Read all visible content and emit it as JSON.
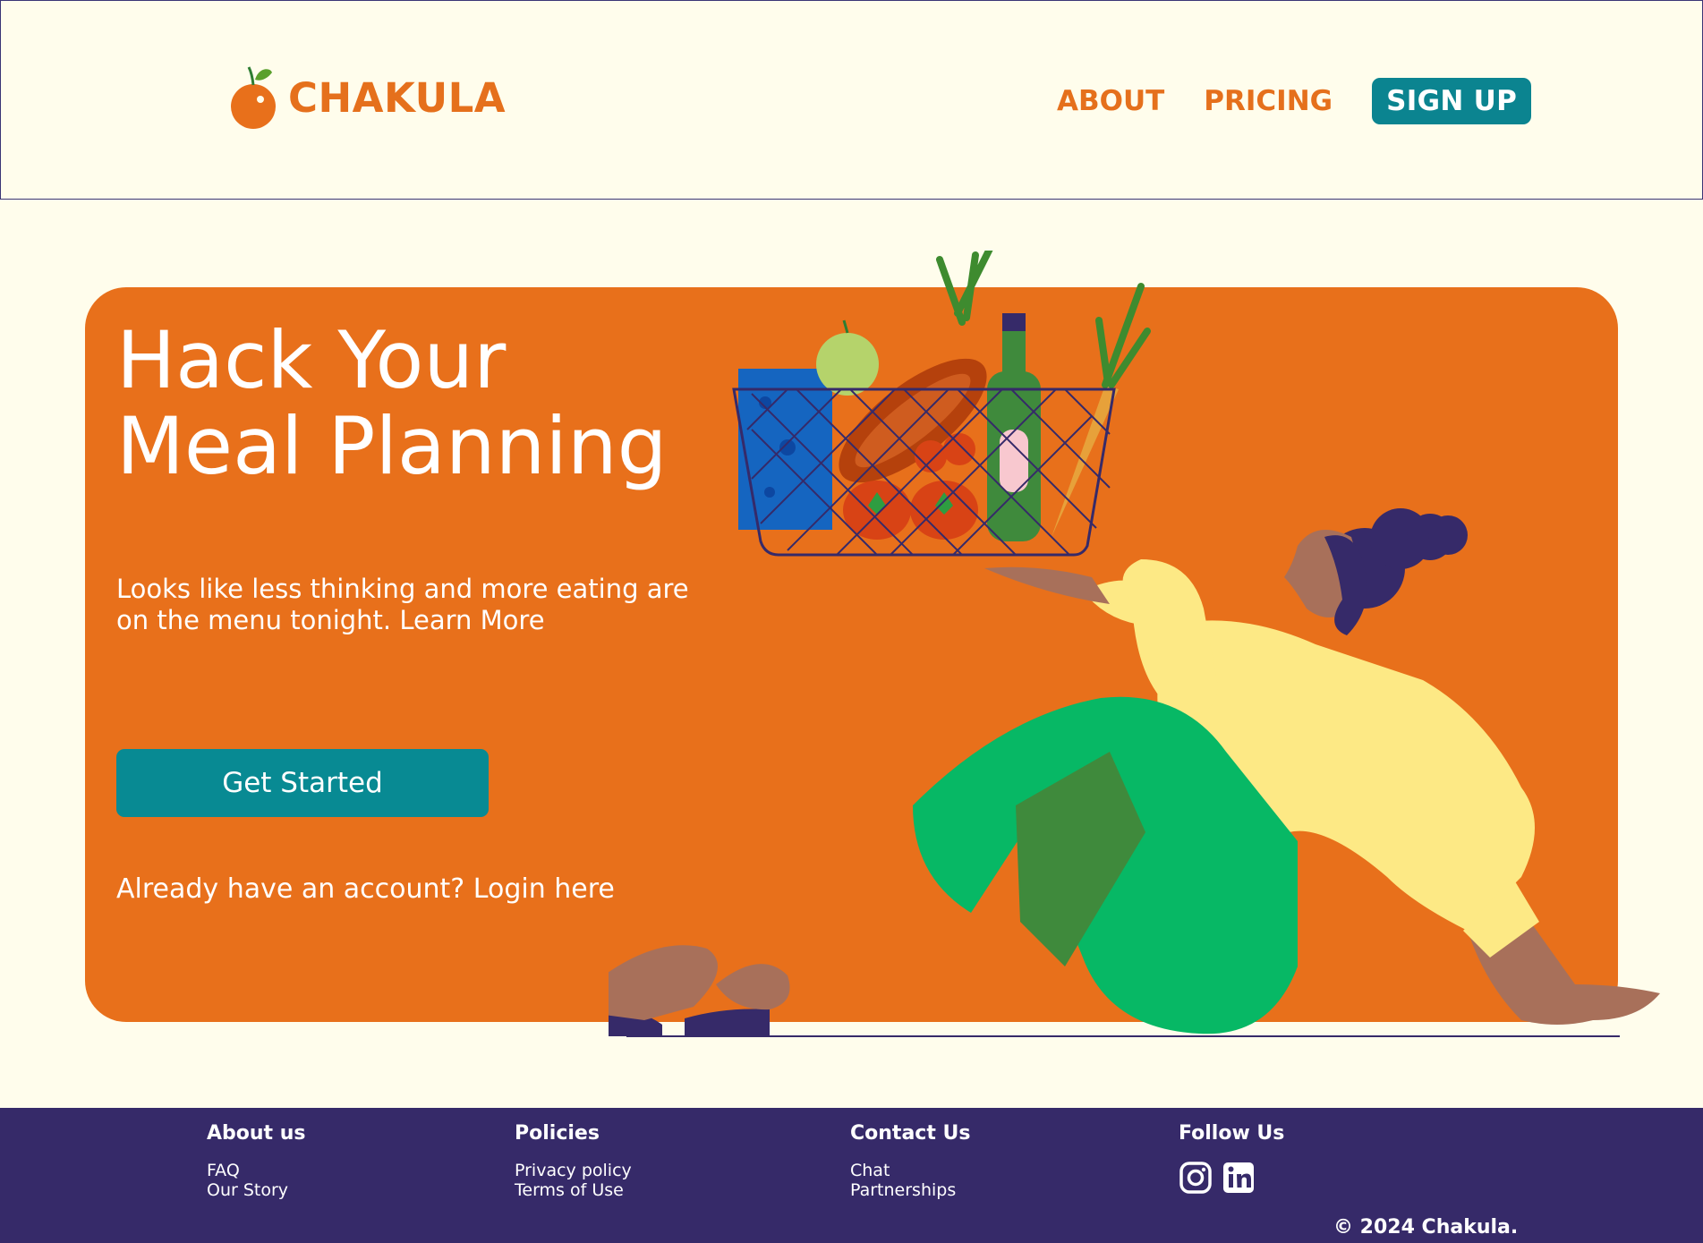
{
  "brand": {
    "name": "CHAKULA",
    "logo_icon": "orange-fruit-icon",
    "primary_color": "#e8701b",
    "accent_color": "#088a93",
    "dark_color": "#362a69",
    "background_color": "#fffdec"
  },
  "nav": {
    "about": "ABOUT",
    "pricing": "PRICING",
    "signup": "SIGN UP"
  },
  "hero": {
    "title": "Hack Your\nMeal Planning",
    "subtitle_text": "Looks like less thinking and more eating are on the menu tonight.",
    "subtitle_link": "Learn More",
    "cta_label": "Get Started",
    "login_prompt": "Already have an account?",
    "login_link": "Login here"
  },
  "footer": {
    "about": {
      "heading": "About us",
      "links": [
        "FAQ",
        "Our Story"
      ]
    },
    "policies": {
      "heading": "Policies",
      "links": [
        "Privacy policy",
        "Terms of Use"
      ]
    },
    "contact": {
      "heading": "Contact Us",
      "links": [
        "Chat",
        "Partnerships"
      ]
    },
    "follow": {
      "heading": "Follow Us",
      "icons": [
        "instagram-icon",
        "linkedin-icon"
      ]
    },
    "copyright": "© 2024 Chakula."
  }
}
